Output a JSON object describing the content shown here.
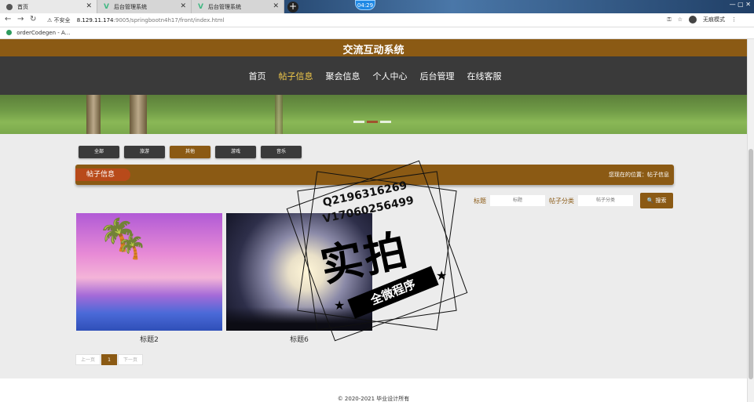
{
  "browser": {
    "tabs": [
      {
        "title": "首页"
      },
      {
        "title": "后台管理系统"
      },
      {
        "title": "后台管理系统"
      }
    ],
    "timer": "04:29",
    "url": {
      "security": "不安全",
      "host": "8.129.11.174",
      "path": ":9005/springbootn4h17/front/index.html"
    },
    "incognito_label": "无痕模式",
    "bookmarks": [
      {
        "label": "orderCodegen - A..."
      }
    ]
  },
  "site": {
    "title": "交流互动系统",
    "nav": [
      {
        "label": "首页",
        "active": false
      },
      {
        "label": "帖子信息",
        "active": true
      },
      {
        "label": "聚会信息",
        "active": false
      },
      {
        "label": "个人中心",
        "active": false
      },
      {
        "label": "后台管理",
        "active": false
      },
      {
        "label": "在线客服",
        "active": false
      }
    ]
  },
  "categories": [
    {
      "label": "全部",
      "active": false
    },
    {
      "label": "旅游",
      "active": false
    },
    {
      "label": "其他",
      "active": true
    },
    {
      "label": "游戏",
      "active": false
    },
    {
      "label": "音乐",
      "active": false
    }
  ],
  "section": {
    "title": "帖子信息",
    "breadcrumb": "您现在的位置：帖子信息"
  },
  "search": {
    "title_label": "标题",
    "title_placeholder": "标题",
    "category_label": "帖子分类",
    "category_placeholder": "帖子分类",
    "button_label": "搜索"
  },
  "posts": [
    {
      "title": "标题2"
    },
    {
      "title": "标题6"
    }
  ],
  "pagination": {
    "prev": "上一页",
    "current": "1",
    "next": "下一页"
  },
  "footer": {
    "copyright": "© 2020-2021 毕业设计所有"
  },
  "watermark": {
    "main": "实拍",
    "banner": "全微程序",
    "line1": "Q2196316269",
    "line2": "V17060256499"
  },
  "colors": {
    "brand": "#8b5a14",
    "nav_bg": "#3a3a3a",
    "nav_active": "#f1c94a",
    "tag": "#b84a1a"
  }
}
